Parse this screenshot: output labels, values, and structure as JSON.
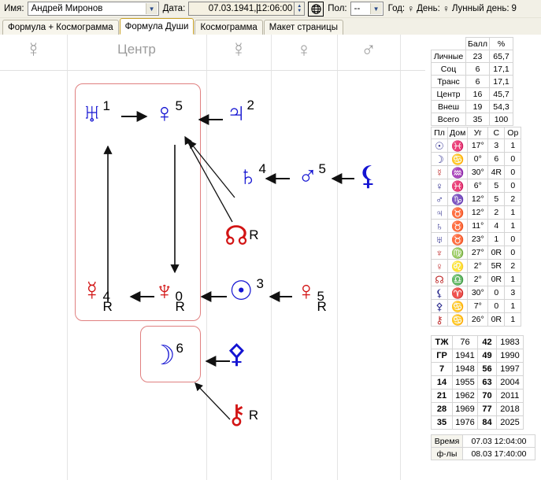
{
  "toolbar": {
    "name_label": "Имя:",
    "name_value": "Андрей Миронов",
    "date_label": "Дата:",
    "date_value": "07.03.1941,",
    "time_value": "12:06:00",
    "globe_icon": "globe-icon",
    "gender_label": "Пол:",
    "gender_value": "--",
    "year_label": "Год:",
    "year_symbol": "♀",
    "day_label": "День:",
    "day_symbol": "♀",
    "lunar_day_label": "Лунный день:",
    "lunar_day_value": "9"
  },
  "tabs": [
    {
      "label": "Формула + Космограмма",
      "active": false
    },
    {
      "label": "Формула Души",
      "active": true
    },
    {
      "label": "Космограмма",
      "active": false
    },
    {
      "label": "Макет страницы",
      "active": false
    }
  ],
  "diagram": {
    "column_headers": [
      {
        "name": "mercury-icon",
        "glyph": "☿",
        "type": "symbol"
      },
      {
        "name": "center-label",
        "glyph": "Центр",
        "type": "text"
      },
      {
        "name": "mercury-icon",
        "glyph": "☿",
        "type": "symbol"
      },
      {
        "name": "venus-icon",
        "glyph": "♀",
        "type": "symbol"
      },
      {
        "name": "mars-icon",
        "glyph": "♂",
        "type": "symbol"
      }
    ],
    "nodes": [
      {
        "id": "uranus",
        "icon": "uranus-icon",
        "glyph": "♅",
        "num": "1",
        "r": "",
        "color": "#1414d2"
      },
      {
        "id": "venus",
        "icon": "venus-icon",
        "glyph": "♀",
        "num": "5",
        "r": "",
        "color": "#1414d2"
      },
      {
        "id": "jupiter",
        "icon": "jupiter-icon",
        "glyph": "♃",
        "num": "2",
        "r": "",
        "color": "#1414d2"
      },
      {
        "id": "saturn",
        "icon": "saturn-icon",
        "glyph": "♄",
        "num": "4",
        "r": "",
        "color": "#1414d2"
      },
      {
        "id": "mars",
        "icon": "mars-icon",
        "glyph": "♂",
        "num": "5",
        "r": "",
        "color": "#1414d2"
      },
      {
        "id": "lilith",
        "icon": "lilith-icon",
        "glyph": "⚸",
        "num": "",
        "r": "",
        "color": "#1414d2"
      },
      {
        "id": "northnode",
        "icon": "north-node-icon",
        "glyph": "☊",
        "num": "",
        "r": "R",
        "color": "#d21414"
      },
      {
        "id": "mercury",
        "icon": "mercury-icon",
        "glyph": "☿",
        "num": "4",
        "r": "R",
        "color": "#d21414"
      },
      {
        "id": "neptune",
        "icon": "neptune-icon",
        "glyph": "♆",
        "num": "0",
        "r": "R",
        "color": "#d21414"
      },
      {
        "id": "sun",
        "icon": "sun-icon",
        "glyph": "☉",
        "num": "3",
        "r": "",
        "color": "#1414d2"
      },
      {
        "id": "pluto",
        "icon": "pluto-icon",
        "glyph": "♀",
        "num": "5",
        "r": "R",
        "color": "#d21414"
      },
      {
        "id": "moon",
        "icon": "moon-icon",
        "glyph": "☽",
        "num": "6",
        "r": "",
        "color": "#1414d2"
      },
      {
        "id": "proserpina",
        "icon": "proserpina-icon",
        "glyph": "⚴",
        "num": "",
        "r": "",
        "color": "#1414d2"
      },
      {
        "id": "chiron",
        "icon": "chiron-icon",
        "glyph": "⚷",
        "num": "",
        "r": "R",
        "color": "#d21414"
      }
    ],
    "arrows": [
      {
        "from": "uranus",
        "to": "venus"
      },
      {
        "from": "jupiter",
        "to": "venus"
      },
      {
        "from": "saturn",
        "to": "venus"
      },
      {
        "from": "northnode",
        "to": "venus"
      },
      {
        "from": "mars",
        "to": "saturn"
      },
      {
        "from": "lilith",
        "to": "mars"
      },
      {
        "from": "venus",
        "to": "neptune"
      },
      {
        "from": "neptune",
        "to": "mercury"
      },
      {
        "from": "mercury",
        "to": "uranus"
      },
      {
        "from": "sun",
        "to": "neptune"
      },
      {
        "from": "pluto",
        "to": "sun"
      },
      {
        "from": "proserpina",
        "to": "moon"
      },
      {
        "from": "chiron",
        "to": "moon"
      }
    ],
    "group_box_color": "#e08080"
  },
  "score_table": {
    "headers": [
      "",
      "Балл",
      "%"
    ],
    "rows": [
      {
        "label": "Личные",
        "score": "23",
        "percent": "65,7"
      },
      {
        "label": "Соц",
        "score": "6",
        "percent": "17,1"
      },
      {
        "label": "Транс",
        "score": "6",
        "percent": "17,1"
      },
      {
        "label": "Центр",
        "score": "16",
        "percent": "45,7"
      },
      {
        "label": "Внеш",
        "score": "19",
        "percent": "54,3"
      },
      {
        "label": "Всего",
        "score": "35",
        "percent": "100"
      }
    ]
  },
  "planets_table": {
    "headers": [
      "Пл",
      "Дом",
      "Уг",
      "С",
      "Ор"
    ],
    "rows": [
      {
        "planet": "☉",
        "planet_name": "sun-icon",
        "planet_color": "#2a2a8c",
        "house": "♓",
        "house_name": "pisces-icon",
        "angle": "17°",
        "c": "3",
        "op": "1"
      },
      {
        "planet": "☽",
        "planet_name": "moon-icon",
        "planet_color": "#2a2a8c",
        "house": "♋",
        "house_name": "cancer-icon",
        "angle": "0°",
        "c": "6",
        "op": "0"
      },
      {
        "planet": "☿",
        "planet_name": "mercury-icon",
        "planet_color": "#c03030",
        "house": "♒",
        "house_name": "aquarius-icon",
        "angle": "30°",
        "c": "4R",
        "op": "0"
      },
      {
        "planet": "♀",
        "planet_name": "venus-icon",
        "planet_color": "#2a2a8c",
        "house": "♓",
        "house_name": "pisces-icon",
        "angle": "6°",
        "c": "5",
        "op": "0"
      },
      {
        "planet": "♂",
        "planet_name": "mars-icon",
        "planet_color": "#2a2a8c",
        "house": "♑",
        "house_name": "capricorn-icon",
        "angle": "12°",
        "c": "5",
        "op": "2"
      },
      {
        "planet": "♃",
        "planet_name": "jupiter-icon",
        "planet_color": "#2a2a8c",
        "house": "♉",
        "house_name": "taurus-icon",
        "angle": "12°",
        "c": "2",
        "op": "1"
      },
      {
        "planet": "♄",
        "planet_name": "saturn-icon",
        "planet_color": "#2a2a8c",
        "house": "♉",
        "house_name": "taurus-icon",
        "angle": "11°",
        "c": "4",
        "op": "1"
      },
      {
        "planet": "♅",
        "planet_name": "uranus-icon",
        "planet_color": "#2a2a8c",
        "house": "♉",
        "house_name": "taurus-icon",
        "angle": "23°",
        "c": "1",
        "op": "0"
      },
      {
        "planet": "♆",
        "planet_name": "neptune-icon",
        "planet_color": "#c03030",
        "house": "♍",
        "house_name": "virgo-icon",
        "angle": "27°",
        "c": "0R",
        "op": "0"
      },
      {
        "planet": "♀",
        "planet_name": "pluto-icon",
        "planet_color": "#c03030",
        "house": "♌",
        "house_name": "leo-icon",
        "angle": "2°",
        "c": "5R",
        "op": "2"
      },
      {
        "planet": "☊",
        "planet_name": "north-node-icon",
        "planet_color": "#c03030",
        "house": "♎",
        "house_name": "libra-icon",
        "angle": "2°",
        "c": "0R",
        "op": "1"
      },
      {
        "planet": "⚸",
        "planet_name": "lilith-icon",
        "planet_color": "#2a2a8c",
        "house": "♈",
        "house_name": "aries-icon",
        "angle": "30°",
        "c": "0",
        "op": "3"
      },
      {
        "planet": "⚴",
        "planet_name": "proserpina-icon",
        "planet_color": "#2a2a8c",
        "house": "♋",
        "house_name": "cancer-icon",
        "angle": "7°",
        "c": "0",
        "op": "1"
      },
      {
        "planet": "⚷",
        "planet_name": "chiron-icon",
        "planet_color": "#c03030",
        "house": "♋",
        "house_name": "cancer-icon",
        "angle": "26°",
        "c": "0R",
        "op": "1"
      }
    ]
  },
  "cycles_table": {
    "rows": [
      {
        "c1": "ТЖ",
        "c2": "76",
        "c3": "42",
        "c4": "1983"
      },
      {
        "c1": "ГР",
        "c2": "1941",
        "c3": "49",
        "c4": "1990"
      },
      {
        "c1": "7",
        "c2": "1948",
        "c3": "56",
        "c4": "1997"
      },
      {
        "c1": "14",
        "c2": "1955",
        "c3": "63",
        "c4": "2004"
      },
      {
        "c1": "21",
        "c2": "1962",
        "c3": "70",
        "c4": "2011"
      },
      {
        "c1": "28",
        "c2": "1969",
        "c3": "77",
        "c4": "2018"
      },
      {
        "c1": "35",
        "c2": "1976",
        "c3": "84",
        "c4": "2025"
      }
    ]
  },
  "time_table": {
    "rows": [
      {
        "label": "Время",
        "value": "07.03 12:04:00"
      },
      {
        "label": "ф-лы",
        "value": "08.03 17:40:00"
      }
    ]
  }
}
